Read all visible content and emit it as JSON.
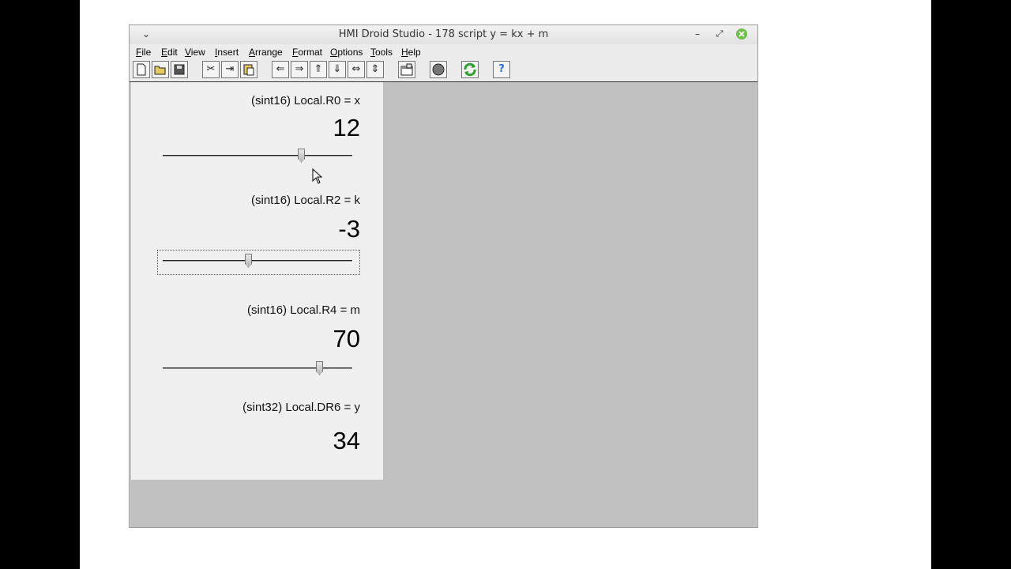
{
  "window": {
    "title": "HMI Droid Studio - 178 script y = kx + m"
  },
  "menu": [
    "File",
    "Edit",
    "View",
    "Insert",
    "Arrange",
    "Format",
    "Options",
    "Tools",
    "Help"
  ],
  "toolbar": {
    "icons": [
      "new-icon",
      "open-icon",
      "save-icon",
      "cut-icon",
      "copy-icon",
      "paste-icon",
      "arrow-left-icon",
      "arrow-right-icon",
      "arrow-up-icon",
      "arrow-down-icon",
      "arrow-left-right-icon",
      "arrow-up-down-icon",
      "properties-icon",
      "record-icon",
      "refresh-icon",
      "help-icon"
    ],
    "help_glyph": "?"
  },
  "panel": {
    "x": {
      "label": "(sint16) Local.R0 = x",
      "value": "12",
      "slider_fraction": 0.74
    },
    "k": {
      "label": "(sint16) Local.R2 = k",
      "value": "-3",
      "slider_fraction": 0.45
    },
    "m": {
      "label": "(sint16) Local.R4 = m",
      "value": "70",
      "slider_fraction": 0.84
    },
    "y": {
      "label": "(sint32) Local.DR6 = y",
      "value": "34"
    }
  },
  "colors": {
    "refresh": "#2aa02a",
    "help": "#2a6fd6",
    "close": "#6cc04a"
  }
}
